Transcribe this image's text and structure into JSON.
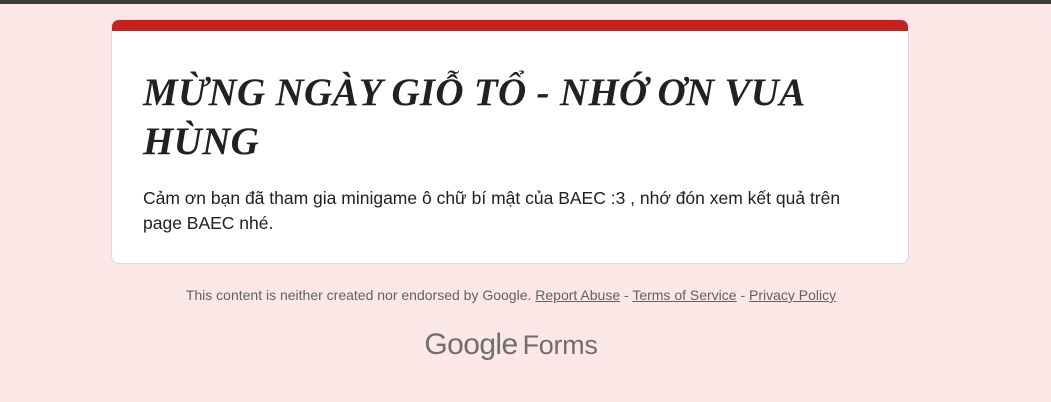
{
  "form": {
    "title": "MỪNG NGÀY GIỖ TỔ - NHỚ ƠN VUA HÙNG",
    "confirmation_message": "Cảm ơn bạn đã tham gia minigame ô chữ bí mật của BAEC :3 , nhớ đón xem kết quả trên page BAEC nhé."
  },
  "footer": {
    "disclaimer": "This content is neither created nor endorsed by Google.",
    "separator": " - ",
    "links": {
      "report_abuse": "Report Abuse",
      "terms": "Terms of Service",
      "privacy": "Privacy Policy"
    }
  },
  "brand": {
    "google": "Google",
    "forms": "Forms"
  },
  "colors": {
    "page_background": "#fbe7e6",
    "accent": "#c5221f",
    "card_background": "#ffffff",
    "text_primary": "#202124",
    "text_secondary": "#5f6368"
  }
}
